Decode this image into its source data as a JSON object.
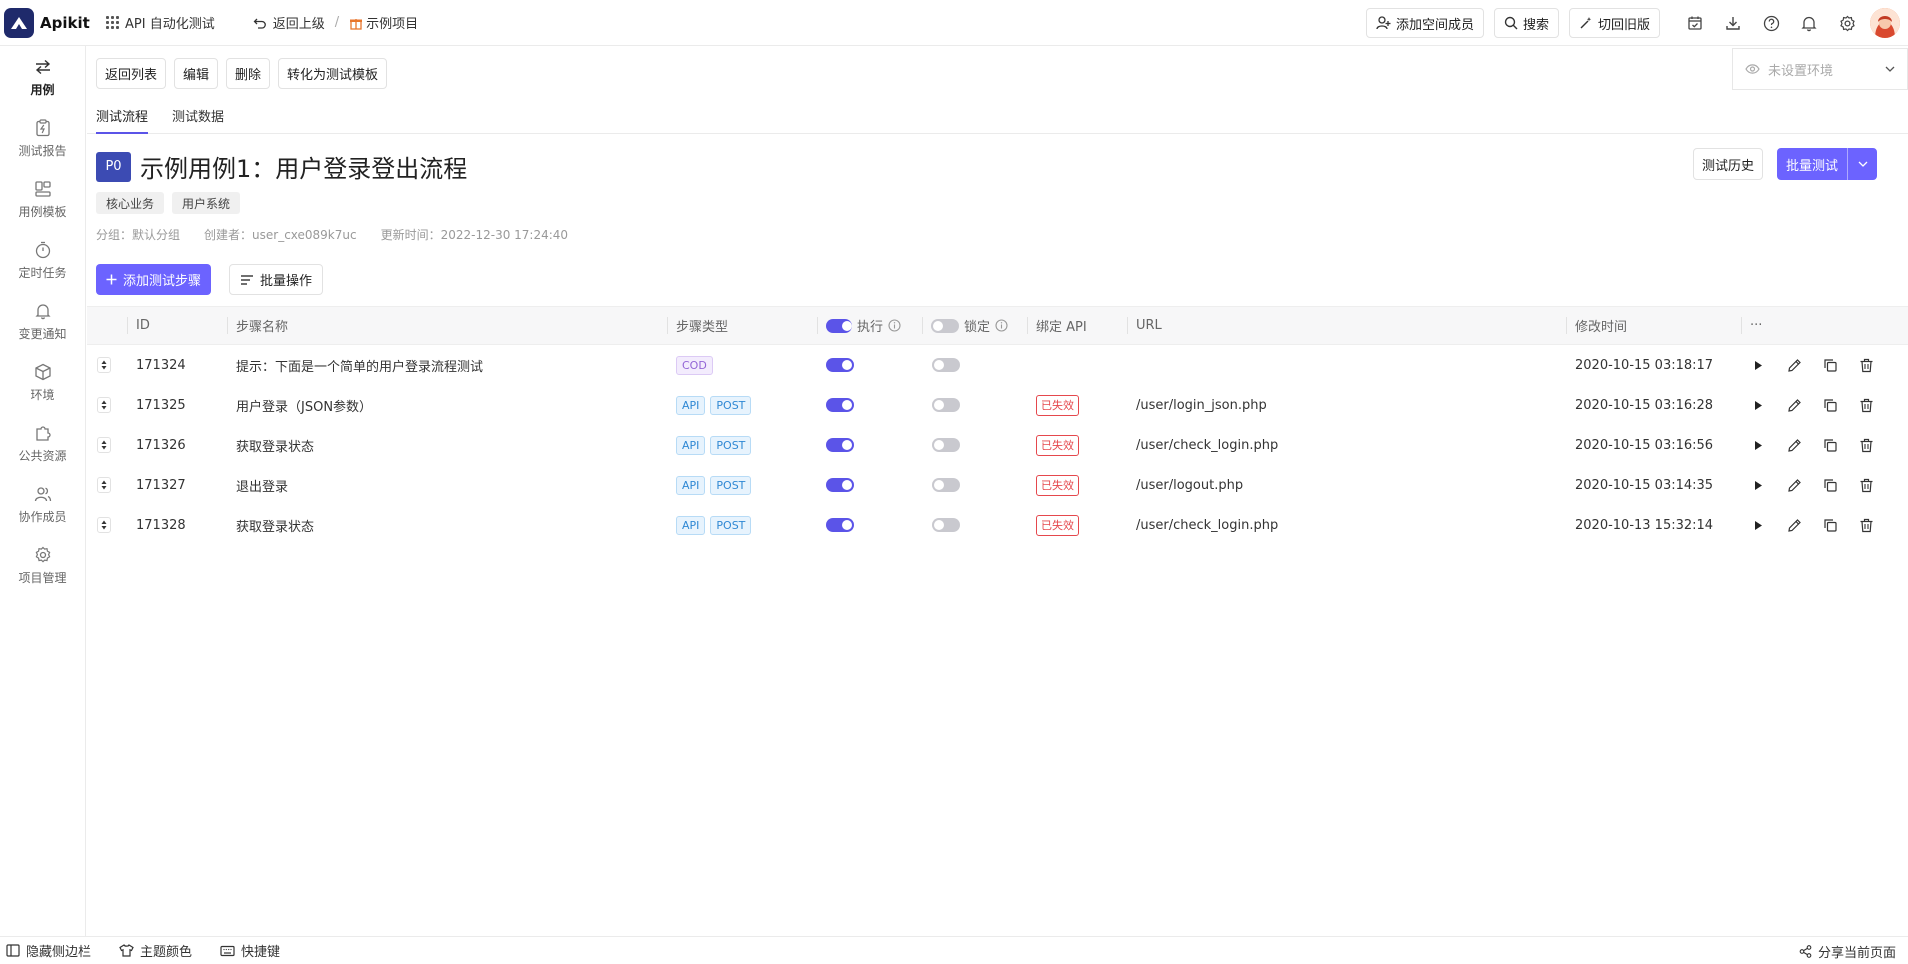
{
  "app": {
    "name": "Apikit",
    "brand_color": "#1f2a6b",
    "accent": "#6c63ff"
  },
  "topbar": {
    "module": "API 自动化测试",
    "back": "返回上级",
    "separator": "/",
    "project": "示例项目",
    "add_member": "添加空间成员",
    "search": "搜索",
    "old_version": "切回旧版",
    "icons": [
      "calendar-check-icon",
      "download-icon",
      "help-icon",
      "bell-icon",
      "settings-icon"
    ]
  },
  "sidebar": {
    "items": [
      {
        "label": "用例",
        "icon": "swap-arrows-icon",
        "active": true
      },
      {
        "label": "测试报告",
        "icon": "report-clipboard-icon"
      },
      {
        "label": "用例模板",
        "icon": "template-icon"
      },
      {
        "label": "定时任务",
        "icon": "timer-icon"
      },
      {
        "label": "变更通知",
        "icon": "bell-icon"
      },
      {
        "label": "环境",
        "icon": "environment-cube-icon"
      },
      {
        "label": "公共资源",
        "icon": "puzzle-icon"
      },
      {
        "label": "协作成员",
        "icon": "users-icon"
      },
      {
        "label": "项目管理",
        "icon": "gear-icon"
      }
    ]
  },
  "actions": {
    "back_to_list": "返回列表",
    "edit": "编辑",
    "delete": "删除",
    "convert": "转化为测试模板"
  },
  "env": {
    "placeholder": "未设置环境"
  },
  "tabs": [
    {
      "label": "测试流程",
      "active": true
    },
    {
      "label": "测试数据",
      "active": false
    }
  ],
  "case": {
    "priority": "P0",
    "title": "示例用例1：用户登录登出流程",
    "tags": [
      "核心业务",
      "用户系统"
    ],
    "meta": {
      "group": "分组：默认分组",
      "creator": "创建者：user_cxe089k7uc",
      "updated": "更新时间：2022-12-30 17:24:40"
    },
    "history_button": "测试历史",
    "batch_test_button": "批量测试"
  },
  "toolbar": {
    "add_step": "添加测试步骤",
    "bulk_ops": "批量操作"
  },
  "table": {
    "headers": {
      "id": "ID",
      "name": "步骤名称",
      "type": "步骤类型",
      "execute": "执行",
      "lock": "锁定",
      "bound_api": "绑定 API",
      "url": "URL",
      "modified": "修改时间",
      "more": "···"
    },
    "header_execute_on": true,
    "header_lock_on": false,
    "rows": [
      {
        "id": "171324",
        "name": "提示：下面是一个简单的用户登录流程测试",
        "types": [
          "COD"
        ],
        "execute": true,
        "lock": false,
        "bound": "",
        "url": "",
        "modified": "2020-10-15 03:18:17"
      },
      {
        "id": "171325",
        "name": "用户登录（JSON参数）",
        "types": [
          "API",
          "POST"
        ],
        "execute": true,
        "lock": false,
        "bound": "已失效",
        "url": "/user/login_json.php",
        "modified": "2020-10-15 03:16:28"
      },
      {
        "id": "171326",
        "name": "获取登录状态",
        "types": [
          "API",
          "POST"
        ],
        "execute": true,
        "lock": false,
        "bound": "已失效",
        "url": "/user/check_login.php",
        "modified": "2020-10-15 03:16:56"
      },
      {
        "id": "171327",
        "name": "退出登录",
        "types": [
          "API",
          "POST"
        ],
        "execute": true,
        "lock": false,
        "bound": "已失效",
        "url": "/user/logout.php",
        "modified": "2020-10-15 03:14:35"
      },
      {
        "id": "171328",
        "name": "获取登录状态",
        "types": [
          "API",
          "POST"
        ],
        "execute": true,
        "lock": false,
        "bound": "已失效",
        "url": "/user/check_login.php",
        "modified": "2020-10-13 15:32:14"
      }
    ]
  },
  "bottombar": {
    "hide_sidebar": "隐藏侧边栏",
    "theme": "主题颜色",
    "shortcuts": "快捷键",
    "share": "分享当前页面"
  }
}
